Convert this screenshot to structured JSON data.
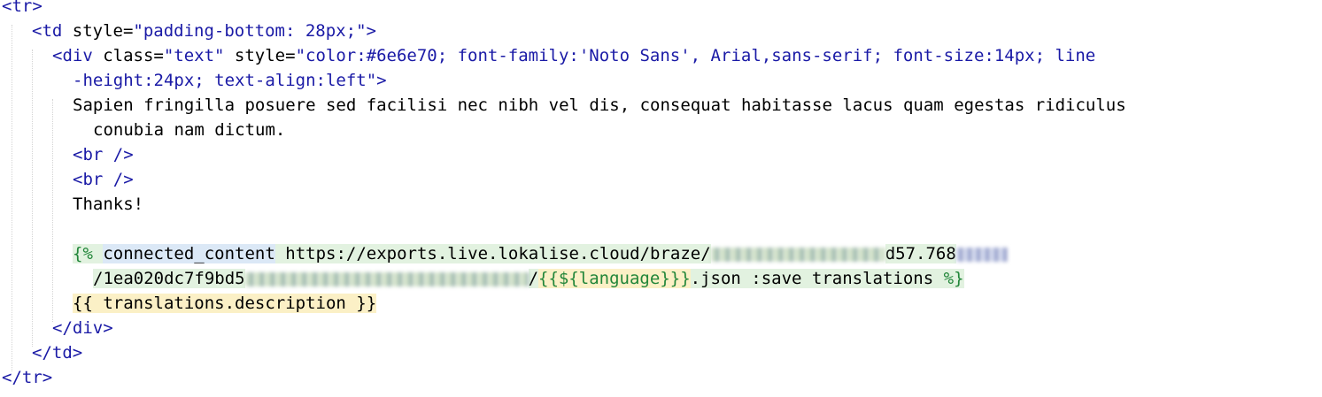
{
  "code": {
    "tr_open": "<tr>",
    "td_open_tag": "<td",
    "td_attr_name": " style=",
    "td_attr_value": "\"padding-bottom: 28px;\"",
    "td_close_bracket": ">",
    "div_open_tag": "<div",
    "div_class_attr": " class=",
    "div_class_value": "\"text\"",
    "div_style_attr": " style=",
    "div_style_value_1": "\"color:#6e6e70; font-family:'Noto Sans', Arial,sans-serif; font-size:14px; line",
    "div_style_value_2": "-height:24px; text-align:left\"",
    "div_close_bracket": ">",
    "text_line_1": "Sapien fringilla posuere sed facilisi nec nibh vel dis, consequat habitasse lacus quam egestas ridiculus",
    "text_line_2": "conubia nam dictum.",
    "br_1": "<br />",
    "br_2": "<br />",
    "thanks": "Thanks!",
    "liquid_open": "{%",
    "connected_content": "connected_content",
    "url_prefix": " https://exports.live.lokalise.cloud/braze/",
    "url_after_blur_1": "d57.768",
    "url_line2_prefix": "/1ea020dc7f9bd5",
    "url_line2_slash": "/",
    "language_expr": "{{${language}}}",
    "url_suffix": ".json :save translations ",
    "liquid_close": "%}",
    "translation_output": "{{ translations.description }}",
    "div_close": "</div>",
    "td_close": "</td>",
    "tr_close": "</tr>"
  }
}
